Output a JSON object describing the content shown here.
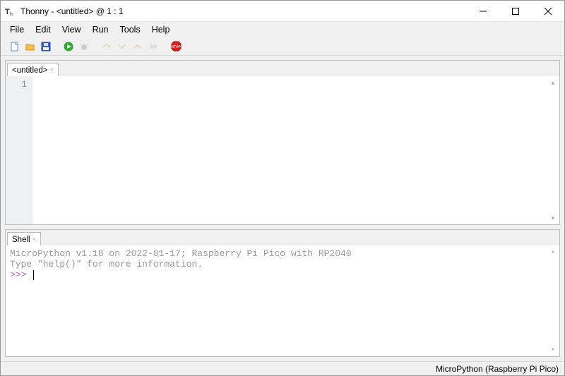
{
  "title": "Thonny  -  <untitled>  @  1 : 1",
  "menu": {
    "file": "File",
    "edit": "Edit",
    "view": "View",
    "run": "Run",
    "tools": "Tools",
    "help": "Help"
  },
  "editor": {
    "tab_label": "<untitled>",
    "line_number": "1",
    "content": ""
  },
  "shell": {
    "tab_label": "Shell",
    "line1": "MicroPython v1.18 on 2022-01-17; Raspberry Pi Pico with RP2040",
    "line2": "Type \"help()\" for more information.",
    "prompt": ">>> "
  },
  "status": {
    "interpreter": "MicroPython (Raspberry Pi Pico)"
  }
}
